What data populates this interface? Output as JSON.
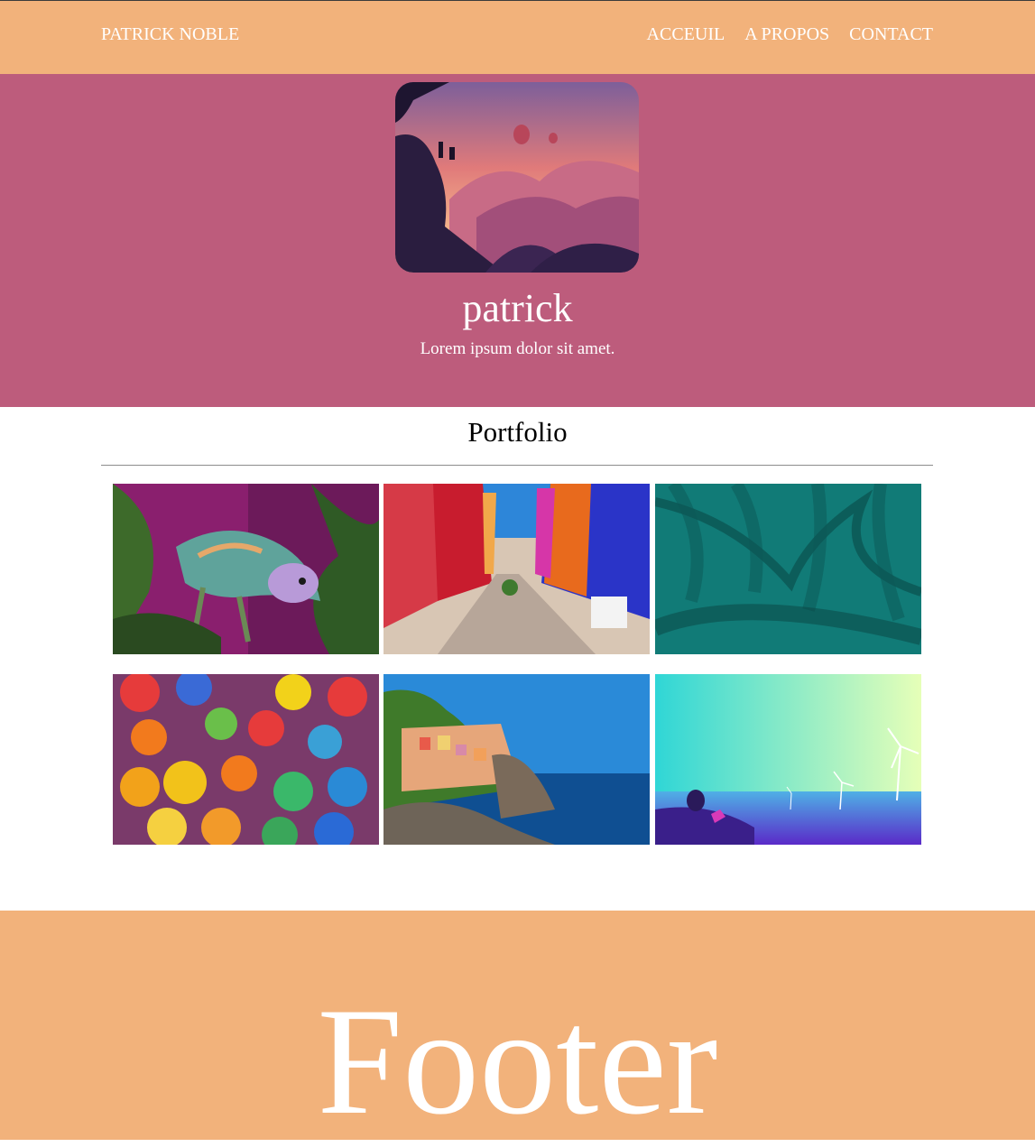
{
  "header": {
    "brand": "PATRICK NOBLE",
    "nav": [
      {
        "label": "ACCEUIL"
      },
      {
        "label": "A PROPOS"
      },
      {
        "label": "CONTACT"
      }
    ]
  },
  "hero": {
    "name": "patrick",
    "tagline": "Lorem ipsum dolor sit amet."
  },
  "portfolio": {
    "title": "Portfolio",
    "items": [
      {
        "subject": "chameleon"
      },
      {
        "subject": "colorful-street"
      },
      {
        "subject": "teal-palm-leaves"
      },
      {
        "subject": "rainbow-balloons"
      },
      {
        "subject": "coastal-village"
      },
      {
        "subject": "wind-turbines"
      }
    ]
  },
  "footer": {
    "text": "Footer"
  },
  "colors": {
    "header_bg": "#f2b27b",
    "hero_bg": "#bd5c7c",
    "footer_bg": "#f2b27b",
    "rule": "#8c8c8c"
  }
}
